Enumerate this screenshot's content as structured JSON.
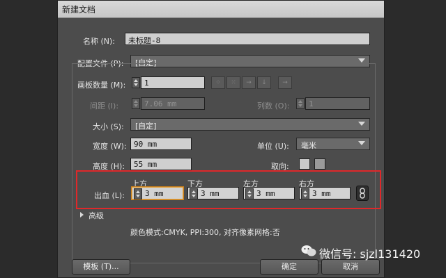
{
  "dialog": {
    "title": "新建文档",
    "name_label": "名称 (N):",
    "name_value": "未标题-8",
    "profile_label": "配置文件 (P):",
    "profile_value": "[自定]",
    "artboards_label": "画板数量 (M):",
    "artboards_value": "1",
    "spacing_label": "间距 (I):",
    "spacing_value": "7.06 mm",
    "columns_label": "列数 (O):",
    "columns_value": "1",
    "size_label": "大小 (S):",
    "size_value": "[自定]",
    "width_label": "宽度 (W):",
    "width_value": "90 mm",
    "units_label": "单位 (U):",
    "units_value": "毫米",
    "height_label": "高度 (H):",
    "height_value": "55 mm",
    "orientation_label": "取向:",
    "bleed": {
      "label": "出血 (L):",
      "top_label": "上方",
      "top_value": "3 mm",
      "bottom_label": "下方",
      "bottom_value": "3 mm",
      "left_label": "左方",
      "left_value": "3 mm",
      "right_label": "右方",
      "right_value": "3 mm"
    },
    "advanced_label": "高级",
    "summary": "颜色模式:CMYK, PPI:300, 对齐像素网格:否",
    "template_button": "模板 (T)...",
    "ok_button": "确定",
    "cancel_button": "取消"
  },
  "watermark": {
    "text": "微信号: sjzl131420"
  },
  "colors": {
    "highlight": "#e0282a",
    "dialog_bg": "#4c4c4c"
  }
}
